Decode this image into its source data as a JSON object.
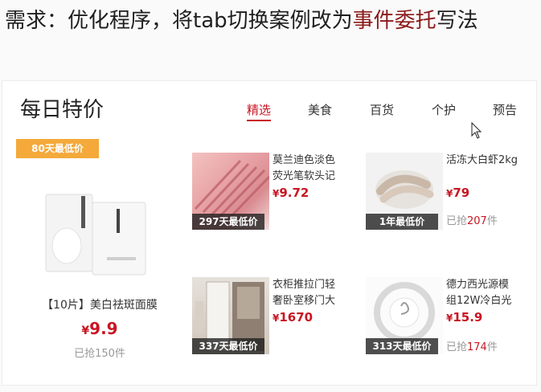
{
  "header": {
    "prefix": "需求：优化程序，将tab切换案例改为",
    "highlight": "事件委托",
    "suffix": "写法"
  },
  "panel": {
    "title": "每日特价",
    "tabs": [
      {
        "label": "精选",
        "active": true
      },
      {
        "label": "美食",
        "active": false
      },
      {
        "label": "百货",
        "active": false
      },
      {
        "label": "个护",
        "active": false
      },
      {
        "label": "预告",
        "active": false
      }
    ],
    "featured": {
      "badge": "80天最低价",
      "name": "【10片】美白祛斑面膜",
      "currency": "¥",
      "price": "9.9",
      "sold": "已抢150件"
    },
    "items": [
      {
        "name": "莫兰迪色淡色荧光笔软头记",
        "currency": "¥",
        "price": "9.72",
        "tag": "297天最低价",
        "sold_prefix": "",
        "sold_num": "",
        "sold_suffix": ""
      },
      {
        "name": "活冻大白虾2kg",
        "currency": "¥",
        "price": "79",
        "tag": "1年最低价",
        "sold_prefix": "已抢",
        "sold_num": "207",
        "sold_suffix": "件"
      },
      {
        "name": "衣柜推拉门轻奢卧室移门大",
        "currency": "¥",
        "price": "1670",
        "tag": "337天最低价",
        "sold_prefix": "",
        "sold_num": "",
        "sold_suffix": ""
      },
      {
        "name": "德力西光源模组12W冷白光",
        "currency": "¥",
        "price": "15.9",
        "tag": "313天最低价",
        "sold_prefix": "已抢",
        "sold_num": "174",
        "sold_suffix": "件"
      }
    ]
  },
  "colors": {
    "accent": "#c81623",
    "badge": "#f4a93a",
    "highlight": "#8b1a1a"
  }
}
